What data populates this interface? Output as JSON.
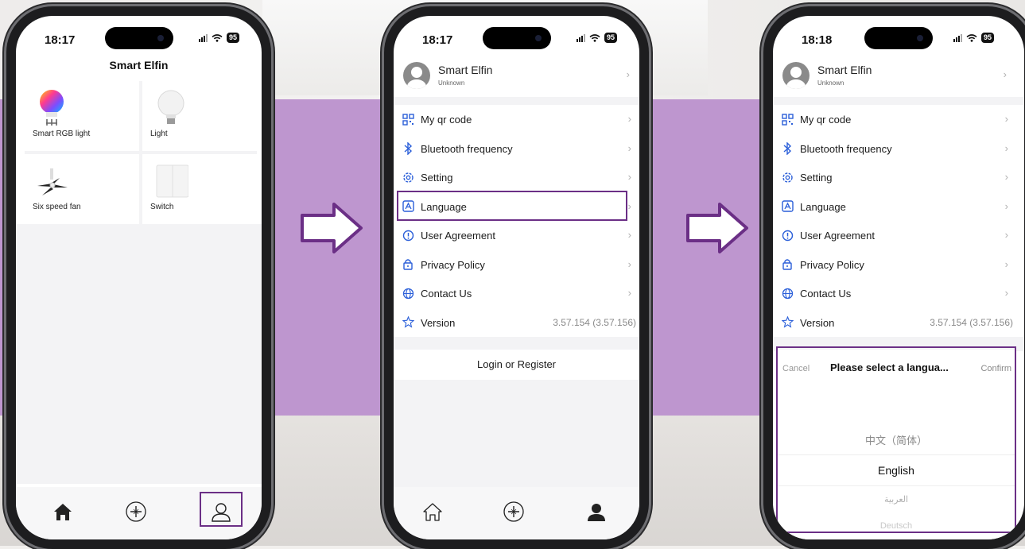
{
  "phone1": {
    "time": "18:17",
    "battery": "95",
    "title": "Smart Elfin",
    "devices": [
      {
        "label": "Smart RGB light",
        "icon": "rgb-bulb-icon"
      },
      {
        "label": "Light",
        "icon": "bulb-icon"
      },
      {
        "label": "Six speed fan",
        "icon": "ceiling-fan-icon"
      },
      {
        "label": "Switch",
        "icon": "wall-switch-icon"
      }
    ],
    "tabs": [
      {
        "name": "home-icon"
      },
      {
        "name": "add-device-icon"
      },
      {
        "name": "profile-icon",
        "selected": true
      }
    ]
  },
  "phone2": {
    "time": "18:17",
    "battery": "95",
    "profile": {
      "name": "Smart Elfin",
      "status": "Unknown"
    },
    "menu": [
      {
        "label": "My qr code",
        "icon": "qr-code-icon"
      },
      {
        "label": "Bluetooth frequency",
        "icon": "bluetooth-icon"
      },
      {
        "label": "Setting",
        "icon": "gear-icon"
      },
      {
        "label": "Language",
        "icon": "language-icon",
        "highlighted": true
      },
      {
        "label": "User Agreement",
        "icon": "info-icon"
      },
      {
        "label": "Privacy Policy",
        "icon": "lock-icon"
      },
      {
        "label": "Contact Us",
        "icon": "globe-icon"
      },
      {
        "label": "Version",
        "icon": "version-icon",
        "value": "3.57.154 (3.57.156)"
      }
    ],
    "login": "Login or Register"
  },
  "phone3": {
    "time": "18:18",
    "battery": "95",
    "profile": {
      "name": "Smart Elfin",
      "status": "Unknown"
    },
    "menu": [
      {
        "label": "My qr code",
        "icon": "qr-code-icon"
      },
      {
        "label": "Bluetooth frequency",
        "icon": "bluetooth-icon"
      },
      {
        "label": "Setting",
        "icon": "gear-icon"
      },
      {
        "label": "Language",
        "icon": "language-icon"
      },
      {
        "label": "User Agreement",
        "icon": "info-icon"
      },
      {
        "label": "Privacy Policy",
        "icon": "lock-icon"
      },
      {
        "label": "Contact Us",
        "icon": "globe-icon"
      },
      {
        "label": "Version",
        "icon": "version-icon",
        "value": "3.57.154 (3.57.156)"
      }
    ],
    "picker": {
      "cancel": "Cancel",
      "title": "Please select a langua...",
      "confirm": "Confirm",
      "options": [
        "中文（简体）",
        "English",
        "العربية",
        "Deutsch"
      ],
      "selected": "English"
    }
  },
  "colors": {
    "band": "#be96cf",
    "accent_purple": "#6b2f86",
    "icon_blue": "#2b5fd9"
  }
}
